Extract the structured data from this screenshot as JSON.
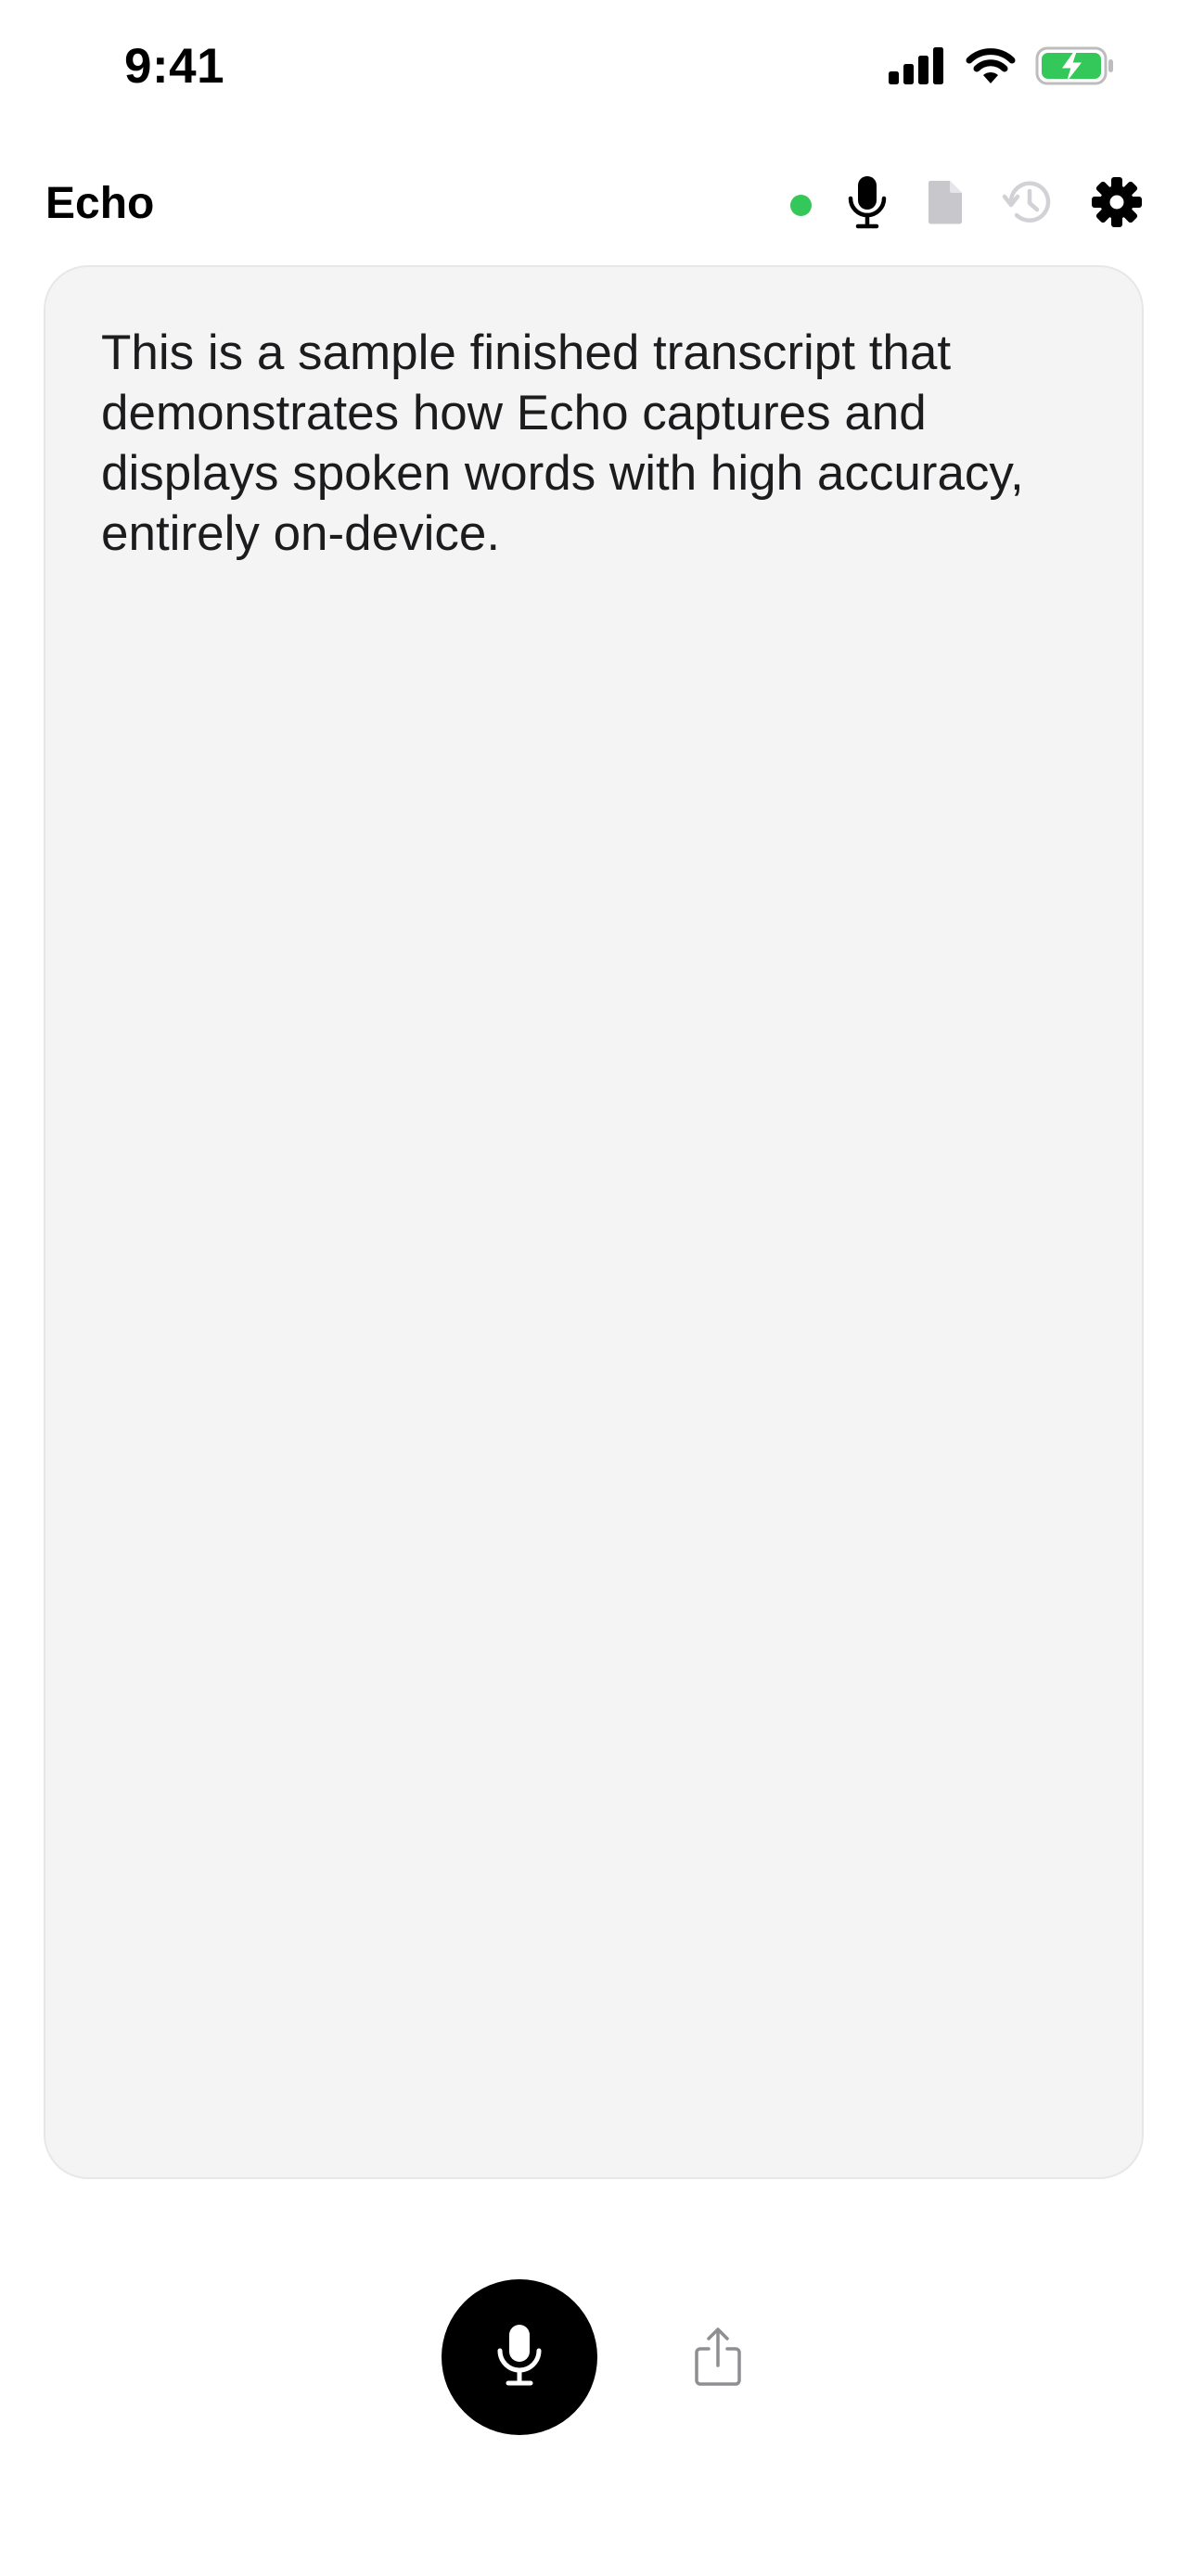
{
  "status_bar": {
    "time": "9:41",
    "icons": [
      "cellular-signal-icon",
      "wifi-icon",
      "battery-charging-icon"
    ],
    "battery_color": "#34c759"
  },
  "header": {
    "title": "Echo",
    "status_indicator_color": "#34c759",
    "tools": [
      {
        "name": "microphone-icon",
        "state": "active"
      },
      {
        "name": "document-icon",
        "state": "disabled"
      },
      {
        "name": "history-icon",
        "state": "disabled"
      },
      {
        "name": "gear-icon",
        "state": "active"
      }
    ]
  },
  "transcript": {
    "text": "This is a sample finished transcript that demonstrates how Echo captures and displays spoken words with high accuracy, entirely on-device."
  },
  "controls": {
    "record_icon": "microphone-icon",
    "share_icon": "share-icon"
  },
  "colors": {
    "accent": "#000000",
    "status_green": "#34c759",
    "card_background": "#f4f4f4",
    "disabled_icon": "#c7c7cc"
  }
}
